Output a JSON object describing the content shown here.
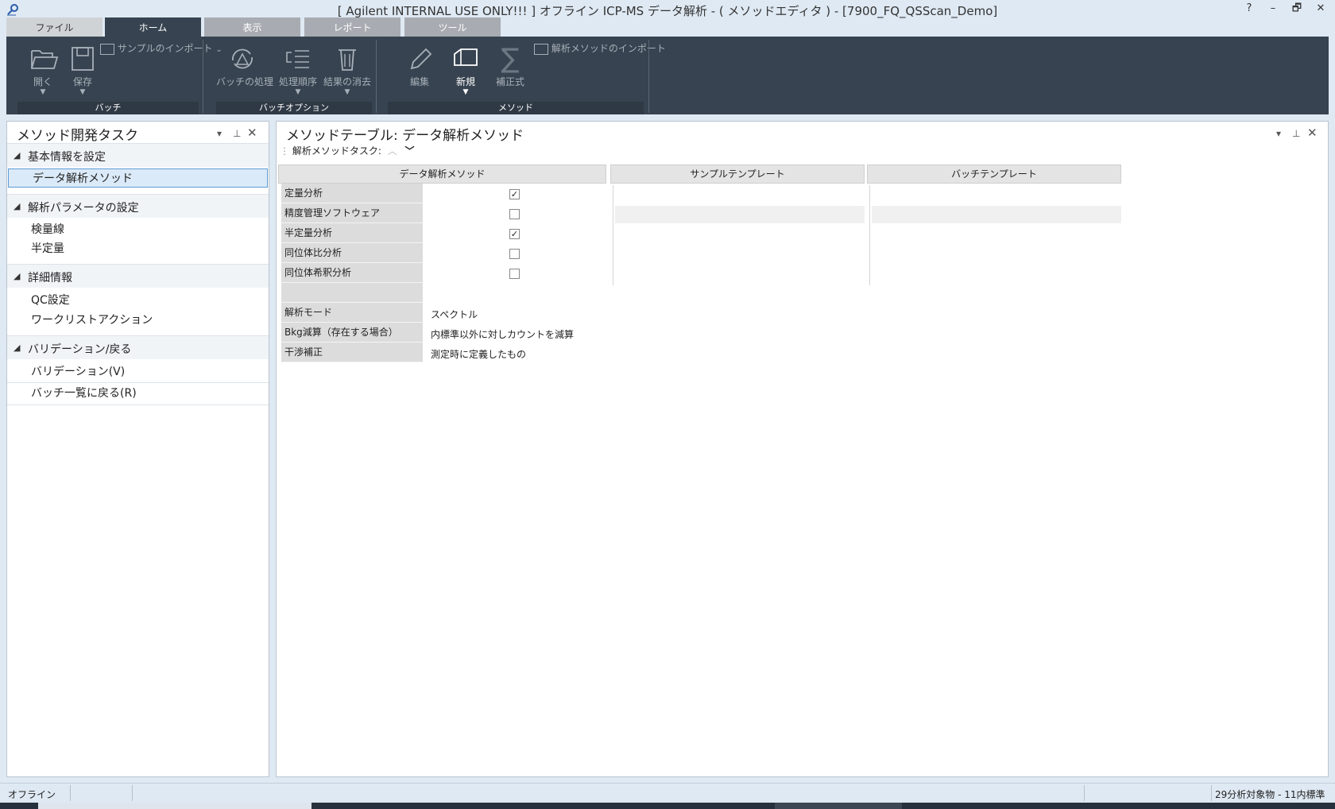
{
  "window": {
    "title": "[ Agilent INTERNAL USE ONLY!!! ] オフライン ICP-MS データ解析 - ( メソッドエディタ ) - [7900_FQ_QSScan_Demo]",
    "controls": [
      "?",
      "–",
      "🗗",
      "✕"
    ]
  },
  "ribbon_tabs": [
    "ファイル",
    "ホーム",
    "表示",
    "レポート",
    "ツール"
  ],
  "ribbon": {
    "open": "開く",
    "save": "保存",
    "import_sample": "サンプルのインポート",
    "batch_process": "バッチの処理",
    "process_order": "処理順序",
    "clear_results": "結果の消去",
    "edit": "編集",
    "new": "新規",
    "correction": "補正式",
    "import_method": "解析メソッドのインポート",
    "group_batch": "バッチ",
    "group_batch_options": "バッチオプション",
    "group_method": "メソッド"
  },
  "left_panel": {
    "title": "メソッド開発タスク",
    "sections": [
      {
        "title": "基本情報を設定",
        "items": [
          "データ解析メソッド"
        ]
      },
      {
        "title": "解析パラメータの設定",
        "items": [
          "検量線",
          "半定量"
        ]
      },
      {
        "title": "詳細情報",
        "items": [
          "QC設定",
          "ワークリストアクション"
        ]
      },
      {
        "title": "バリデーション/戻る",
        "items": [
          "バリデーション(V)",
          "バッチ一覧に戻る(R)"
        ]
      }
    ]
  },
  "main_panel": {
    "title": "メソッドテーブル: データ解析メソッド",
    "tasks_label": "解析メソッドタスク:",
    "columns": [
      "データ解析メソッド",
      "サンプルテンプレート",
      "バッチテンプレート"
    ],
    "check_rows": [
      {
        "label": "定量分析",
        "checked": true
      },
      {
        "label": "精度管理ソフトウェア",
        "checked": false
      },
      {
        "label": "半定量分析",
        "checked": true
      },
      {
        "label": "同位体比分析",
        "checked": false
      },
      {
        "label": "同位体希釈分析",
        "checked": false
      }
    ],
    "settings": [
      {
        "label": "解析モード",
        "value": "スペクトル"
      },
      {
        "label": "Bkg減算（存在する場合）",
        "value": "内標準以外に対しカウントを減算"
      },
      {
        "label": "干渉補正",
        "value": "測定時に定義したもの"
      }
    ]
  },
  "status_bar": {
    "mode": "オフライン",
    "summary": "29分析対象物 - 11内標準"
  }
}
